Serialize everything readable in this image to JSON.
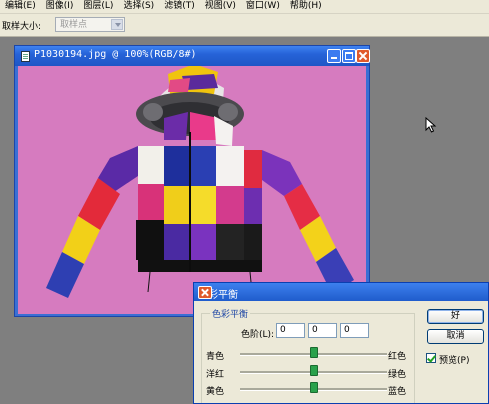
{
  "menu": [
    "编辑(E)",
    "图像(I)",
    "图层(L)",
    "选择(S)",
    "滤镜(T)",
    "视图(V)",
    "窗口(W)",
    "帮助(H)"
  ],
  "options": {
    "sample_size_label": "取样大小:",
    "sample_size_value": "取样点"
  },
  "image_window": {
    "title": "P1030194.jpg @ 100%(RGB/8#)"
  },
  "dialog": {
    "title": "色彩平衡",
    "group_label": "色彩平衡",
    "levels_label": "色阶(L):",
    "levels": [
      "0",
      "0",
      "0"
    ],
    "sliders": [
      {
        "left": "青色",
        "right": "红色",
        "value": 0
      },
      {
        "left": "洋红",
        "right": "绿色",
        "value": 0
      },
      {
        "left": "黄色",
        "right": "蓝色",
        "value": 0
      }
    ],
    "ok_label": "好",
    "cancel_label": "取消",
    "preview_label": "预览(P)",
    "preview_checked": true
  },
  "colors": {
    "canvas_bg": "#d87ac0",
    "title_blue": "#2663d8",
    "thumb_green": "#2aa14b"
  }
}
